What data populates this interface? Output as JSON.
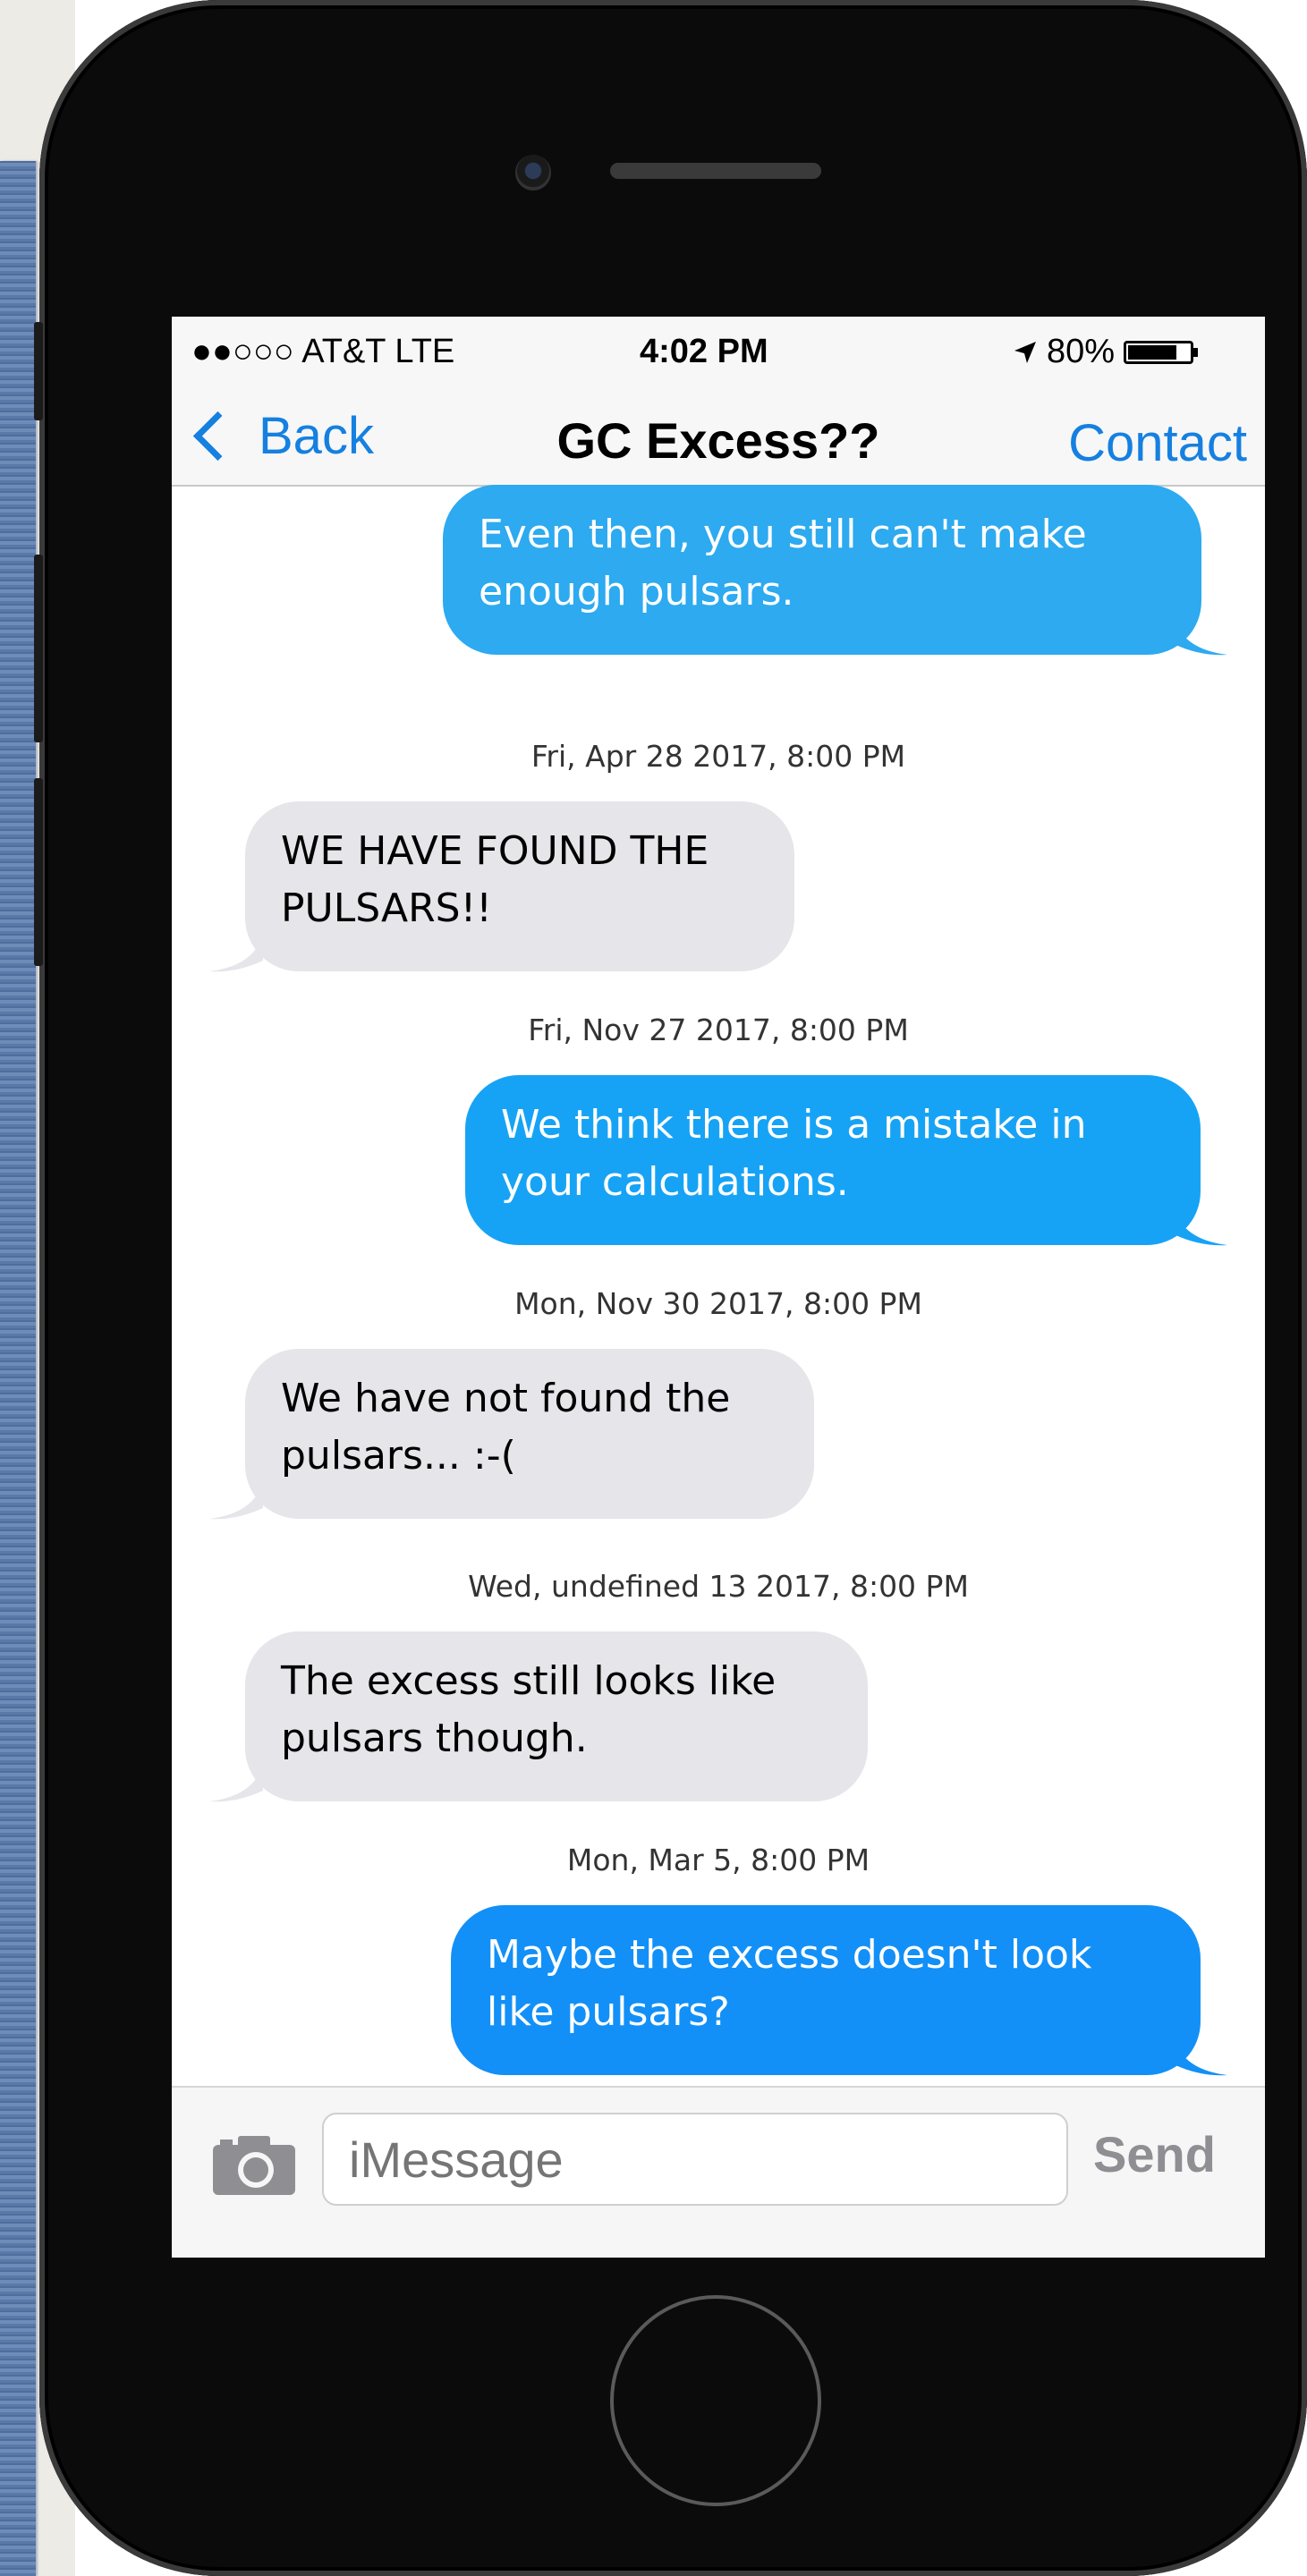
{
  "status_bar": {
    "carrier": "●●○○○ AT&T LTE",
    "time": "4:02 PM",
    "battery": "80%",
    "battery_level": 0.8
  },
  "nav": {
    "back_label": "Back",
    "title": "GC Excess??",
    "contact_label": "Contact"
  },
  "messages": [
    {
      "side": "sent",
      "text": "Even then, you still can't make enough pulsars.",
      "color": "#2daaf0"
    },
    {
      "stamp": "Fri, Apr 28 2017, 8:00 PM"
    },
    {
      "side": "received",
      "text": "WE HAVE FOUND THE PULSARS!!"
    },
    {
      "stamp": "Fri, Nov 27 2017, 8:00 PM"
    },
    {
      "side": "sent",
      "text": "We think there is a mistake in your calculations.",
      "color": "#17a3f5"
    },
    {
      "stamp": "Mon, Nov 30 2017, 8:00 PM"
    },
    {
      "side": "received",
      "text": "We have not found the pulsars... :-("
    },
    {
      "stamp": "Wed, undefined 13 2017, 8:00 PM"
    },
    {
      "side": "received",
      "text": "The excess still looks like pulsars though."
    },
    {
      "stamp": "Mon, Mar 5, 8:00 PM"
    },
    {
      "side": "sent",
      "text": "Maybe the excess doesn't look like pulsars?",
      "color": "#1290f7"
    }
  ],
  "input": {
    "placeholder": "iMessage",
    "send_label": "Send"
  },
  "colors": {
    "ios_blue": "#1580e0",
    "received_bubble": "#e5e5ea"
  }
}
